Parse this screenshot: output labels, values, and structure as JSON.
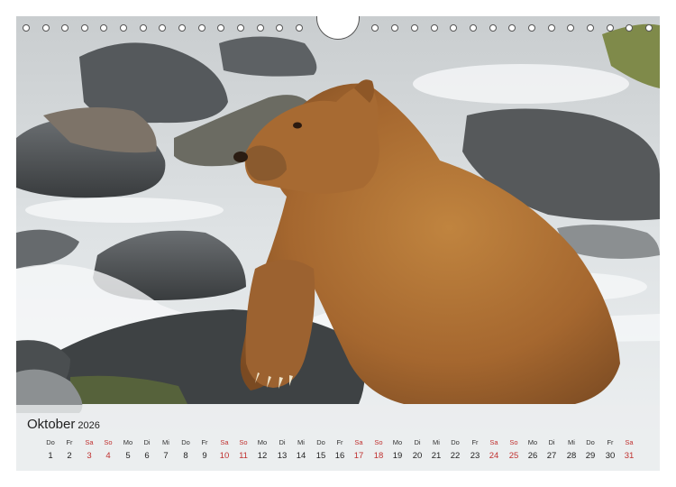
{
  "calendar": {
    "month": "Oktober",
    "year": "2026",
    "days": [
      {
        "dow": "Do",
        "num": "1",
        "weekend": false
      },
      {
        "dow": "Fr",
        "num": "2",
        "weekend": false
      },
      {
        "dow": "Sa",
        "num": "3",
        "weekend": true
      },
      {
        "dow": "So",
        "num": "4",
        "weekend": true
      },
      {
        "dow": "Mo",
        "num": "5",
        "weekend": false
      },
      {
        "dow": "Di",
        "num": "6",
        "weekend": false
      },
      {
        "dow": "Mi",
        "num": "7",
        "weekend": false
      },
      {
        "dow": "Do",
        "num": "8",
        "weekend": false
      },
      {
        "dow": "Fr",
        "num": "9",
        "weekend": false
      },
      {
        "dow": "Sa",
        "num": "10",
        "weekend": true
      },
      {
        "dow": "So",
        "num": "11",
        "weekend": true
      },
      {
        "dow": "Mo",
        "num": "12",
        "weekend": false
      },
      {
        "dow": "Di",
        "num": "13",
        "weekend": false
      },
      {
        "dow": "Mi",
        "num": "14",
        "weekend": false
      },
      {
        "dow": "Do",
        "num": "15",
        "weekend": false
      },
      {
        "dow": "Fr",
        "num": "16",
        "weekend": false
      },
      {
        "dow": "Sa",
        "num": "17",
        "weekend": true
      },
      {
        "dow": "So",
        "num": "18",
        "weekend": true
      },
      {
        "dow": "Mo",
        "num": "19",
        "weekend": false
      },
      {
        "dow": "Di",
        "num": "20",
        "weekend": false
      },
      {
        "dow": "Mi",
        "num": "21",
        "weekend": false
      },
      {
        "dow": "Do",
        "num": "22",
        "weekend": false
      },
      {
        "dow": "Fr",
        "num": "23",
        "weekend": false
      },
      {
        "dow": "Sa",
        "num": "24",
        "weekend": true
      },
      {
        "dow": "So",
        "num": "25",
        "weekend": true
      },
      {
        "dow": "Mo",
        "num": "26",
        "weekend": false
      },
      {
        "dow": "Di",
        "num": "27",
        "weekend": false
      },
      {
        "dow": "Mi",
        "num": "28",
        "weekend": false
      },
      {
        "dow": "Do",
        "num": "29",
        "weekend": false
      },
      {
        "dow": "Fr",
        "num": "30",
        "weekend": false
      },
      {
        "dow": "Sa",
        "num": "31",
        "weekend": true
      }
    ]
  },
  "colors": {
    "weekend": "#c0302f",
    "bear_fur": "#a9703a",
    "rock": "#4f5356",
    "water": "#e8ecee"
  }
}
